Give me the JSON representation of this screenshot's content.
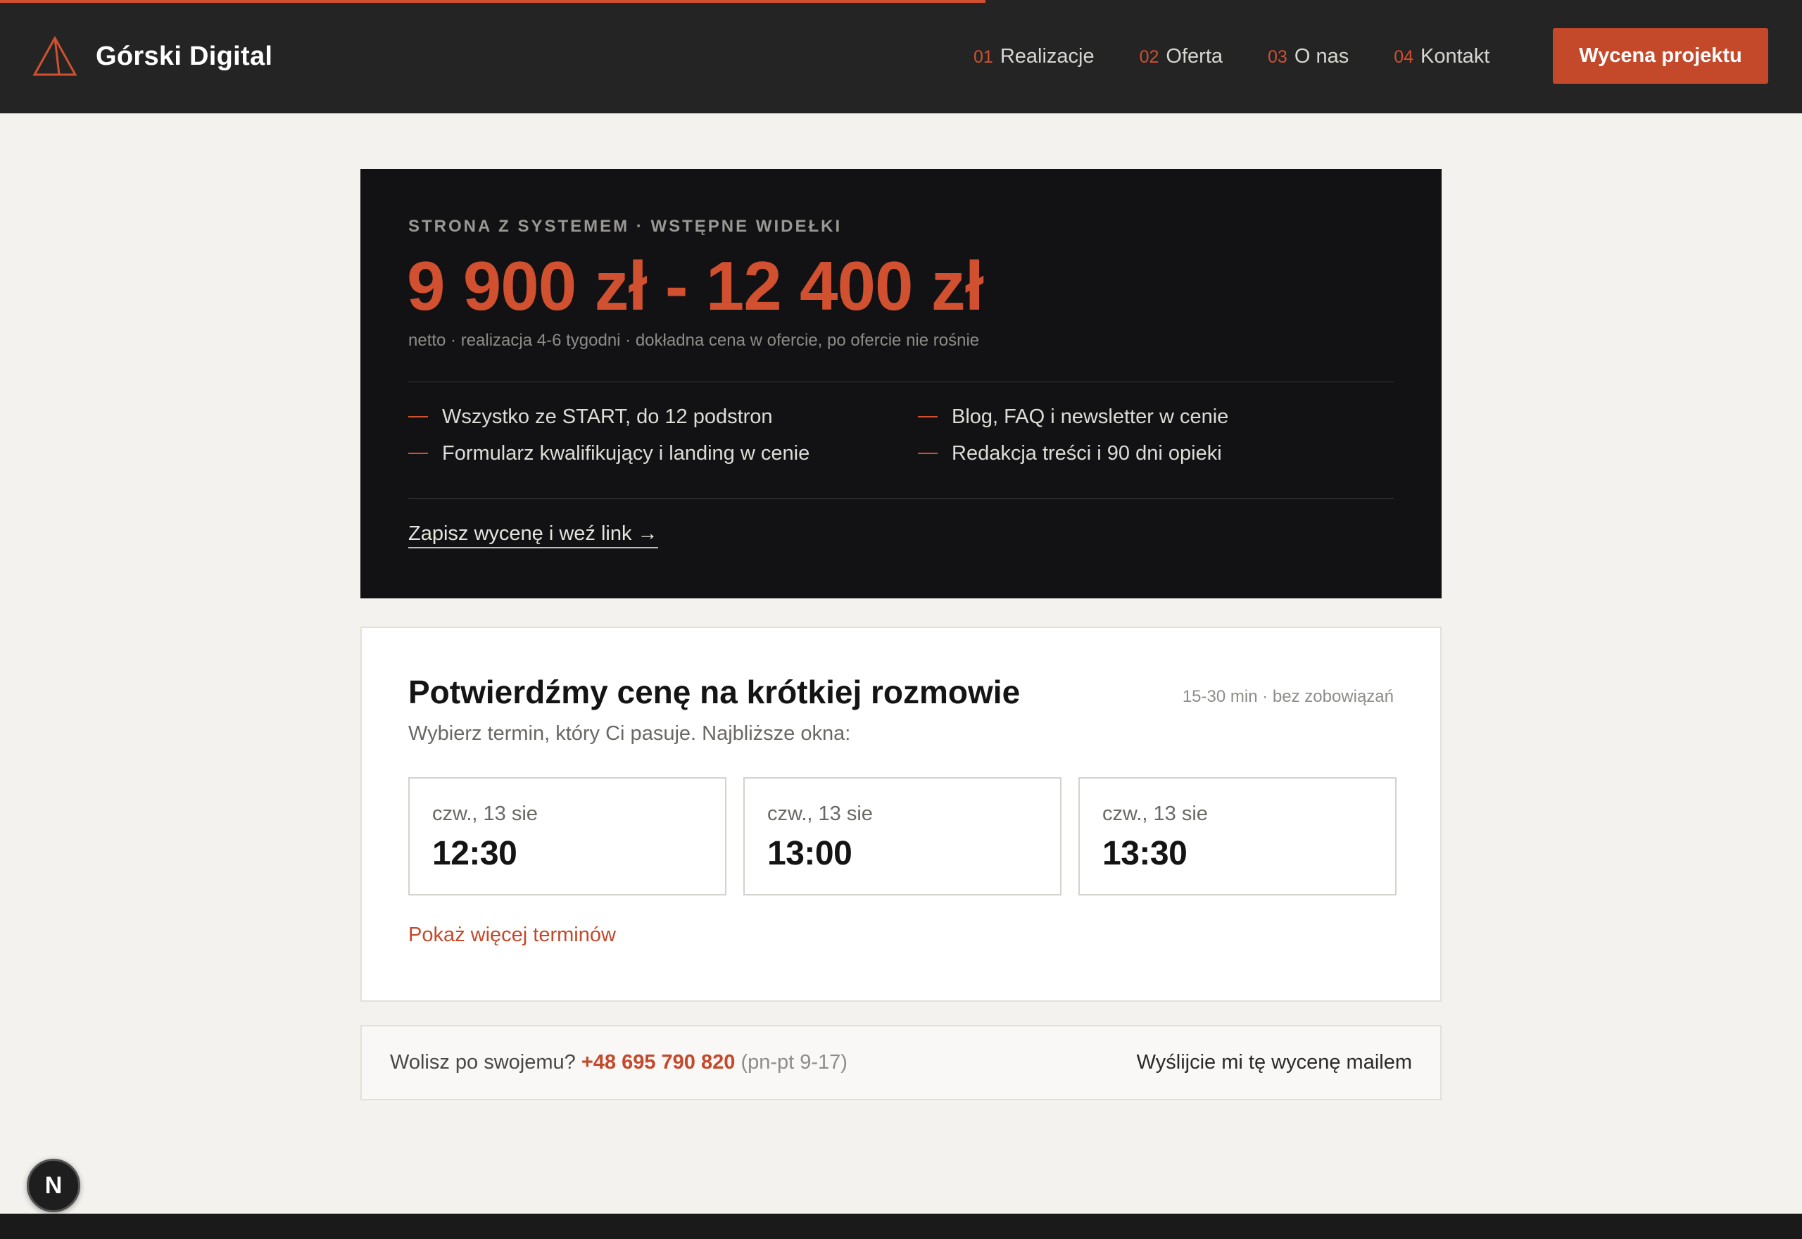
{
  "brand": {
    "name": "Górski Digital",
    "accent": "#d0502f"
  },
  "nav": {
    "items": [
      {
        "num": "01",
        "label": "Realizacje"
      },
      {
        "num": "02",
        "label": "Oferta"
      },
      {
        "num": "03",
        "label": "O nas"
      },
      {
        "num": "04",
        "label": "Kontakt"
      }
    ],
    "cta": "Wycena projektu"
  },
  "price": {
    "eyebrow": "STRONA Z SYSTEMEM · WSTĘPNE WIDEŁKI",
    "range": "9 900 zł - 12 400 zł",
    "note": "netto · realizacja 4-6 tygodni · dokładna cena w ofercie, po ofercie nie rośnie",
    "features": [
      "Wszystko ze START, do 12 podstron",
      "Blog, FAQ i newsletter w cenie",
      "Formularz kwalifikujący i landing w cenie",
      "Redakcja treści i 90 dni opieki"
    ],
    "link": "Zapisz wycenę i weź link →"
  },
  "booking": {
    "title": "Potwierdźmy cenę na krótkiej rozmowie",
    "meta": "15-30 min · bez zobowiązań",
    "subtitle": "Wybierz termin, który Ci pasuje. Najbliższe okna:",
    "slots": [
      {
        "day": "czw., 13 sie",
        "time": "12:30"
      },
      {
        "day": "czw., 13 sie",
        "time": "13:00"
      },
      {
        "day": "czw., 13 sie",
        "time": "13:30"
      }
    ],
    "more": "Pokaż więcej terminów"
  },
  "contact": {
    "prefix": "Wolisz po swojemu?",
    "phone": "+48 695 790 820",
    "hours": "(pn-pt 9-17)",
    "email_link": "Wyślijcie mi tę wycenę mailem"
  },
  "badge": {
    "letter": "N"
  }
}
